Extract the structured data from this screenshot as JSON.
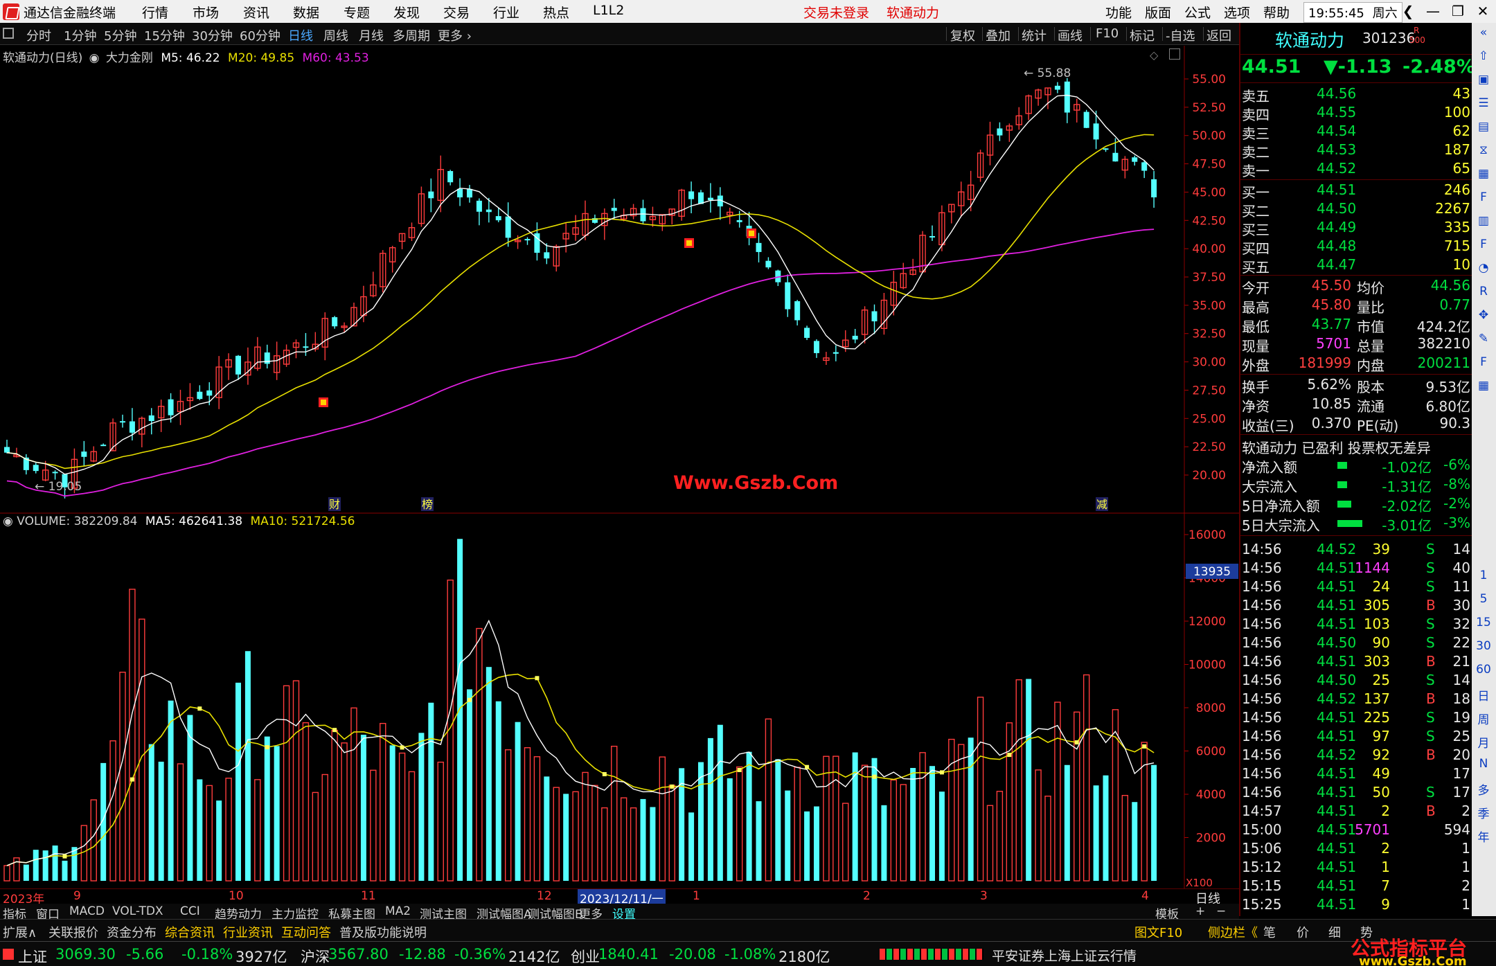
{
  "titlebar": {
    "app_title": "通达信金融终端",
    "menu": [
      "行情",
      "市场",
      "资讯",
      "数据",
      "专题",
      "发现",
      "交易",
      "行业",
      "热点",
      "L1L2"
    ],
    "trade_status": "交易未登录",
    "stock_name": "软通动力",
    "right_menu": [
      "功能",
      "版面",
      "公式",
      "选项",
      "帮助"
    ],
    "clock": "19:55:45",
    "weekday": "周六"
  },
  "periodbar": {
    "periods": [
      "分时",
      "1分钟",
      "5分钟",
      "15分钟",
      "30分钟",
      "60分钟",
      "日线",
      "周线",
      "月线",
      "多周期",
      "更多"
    ],
    "active": "日线",
    "tools": [
      "复权",
      "叠加",
      "统计",
      "画线",
      "F10",
      "标记",
      "-自选",
      "返回"
    ]
  },
  "kline": {
    "legend_name": "软通动力(日线)",
    "indicator": "大力金刚",
    "m5_label": "M5: 46.22",
    "m20_label": "M20: 49.85",
    "m60_label": "M60: 43.53",
    "high_label": "55.88",
    "low_label": "19.05",
    "y_ticks": [
      "55.00",
      "52.50",
      "50.00",
      "47.50",
      "45.00",
      "42.50",
      "40.00",
      "37.50",
      "35.00",
      "32.50",
      "30.00",
      "27.50",
      "25.00",
      "22.50",
      "20.00"
    ],
    "markers": [
      "财",
      "榜",
      "减"
    ],
    "site_watermark": "Www.Gszb.Com"
  },
  "volume": {
    "legend_volume": "VOLUME: 382209.84",
    "legend_ma5": "MA5: 462641.38",
    "legend_ma10": "MA10: 521724.56",
    "y_ticks": [
      "16000",
      "14000",
      "12000",
      "10000",
      "8000",
      "6000",
      "4000",
      "2000"
    ],
    "cursor_value": "13935",
    "unit": "X100"
  },
  "xaxis": {
    "labels": [
      "2023年",
      "9",
      "10",
      "11",
      "12",
      "2023/12/11/一",
      "1",
      "2",
      "3",
      "4"
    ],
    "period_label": "日线"
  },
  "tabs1": [
    "指标",
    "窗口",
    "MACD",
    "VOL-TDX",
    "CCI",
    "趋势动力",
    "主力监控",
    "私募主图",
    "MA2",
    "测试主图",
    "测试幅图A",
    "测试幅图B",
    "更多",
    "设置"
  ],
  "tabs1_right": [
    "模板",
    "+",
    "−"
  ],
  "tabs2": [
    "扩展∧",
    "关联报价",
    "资金分布",
    "综合资讯",
    "行业资讯",
    "互动问答",
    "普及版功能说明"
  ],
  "tabs2_right": [
    "图文F10",
    "侧边栏《",
    "笔",
    "价",
    "细",
    "势"
  ],
  "quote": {
    "name": "软通动力",
    "code": "301236",
    "badge_top": "R",
    "badge_bottom": "500",
    "price": "44.51",
    "change": "▼-1.13",
    "change_pct": "-2.48%",
    "asks": [
      {
        "label": "卖五",
        "price": "44.56",
        "vol": "43"
      },
      {
        "label": "卖四",
        "price": "44.55",
        "vol": "100"
      },
      {
        "label": "卖三",
        "price": "44.54",
        "vol": "62"
      },
      {
        "label": "卖二",
        "price": "44.53",
        "vol": "187"
      },
      {
        "label": "卖一",
        "price": "44.52",
        "vol": "65"
      }
    ],
    "bids": [
      {
        "label": "买一",
        "price": "44.51",
        "vol": "246"
      },
      {
        "label": "买二",
        "price": "44.50",
        "vol": "2267"
      },
      {
        "label": "买三",
        "price": "44.49",
        "vol": "335"
      },
      {
        "label": "买四",
        "price": "44.48",
        "vol": "715"
      },
      {
        "label": "买五",
        "price": "44.47",
        "vol": "10"
      }
    ],
    "stats": [
      {
        "l1": "今开",
        "v1": "45.50",
        "l2": "均价",
        "v2": "44.56",
        "c1": "red2",
        "c2": "green"
      },
      {
        "l1": "最高",
        "v1": "45.80",
        "l2": "量比",
        "v2": "0.77",
        "c1": "red2",
        "c2": "green"
      },
      {
        "l1": "最低",
        "v1": "43.77",
        "l2": "市值",
        "v2": "424.2亿",
        "c1": "green",
        "c2": "white"
      },
      {
        "l1": "现量",
        "v1": "5701",
        "l2": "总量",
        "v2": "382210",
        "c1": "magenta",
        "c2": "white"
      },
      {
        "l1": "外盘",
        "v1": "181999",
        "l2": "内盘",
        "v2": "200211",
        "c1": "red2",
        "c2": "green"
      }
    ],
    "stats2": [
      {
        "l1": "换手",
        "v1": "5.62%",
        "l2": "股本",
        "v2": "9.53亿"
      },
      {
        "l1": "净资",
        "v1": "10.85",
        "l2": "流通",
        "v2": "6.80亿"
      },
      {
        "l1": "收益(三)",
        "v1": "0.370",
        "l2": "PE(动)",
        "v2": "90.3"
      }
    ],
    "tag_line": "软通动力 已盈利 投票权无差异",
    "flows": [
      {
        "label": "净流入额",
        "value": "-1.02亿",
        "pct": "-6%"
      },
      {
        "label": "大宗流入",
        "value": "-1.31亿",
        "pct": "-8%"
      },
      {
        "label": "5日净流入额",
        "value": "-2.02亿",
        "pct": "-2%"
      },
      {
        "label": "5日大宗流入",
        "value": "-3.01亿",
        "pct": "-3%"
      }
    ],
    "ticks": [
      {
        "t": "14:56",
        "p": "44.52",
        "v": "39",
        "s": "S",
        "n": "14"
      },
      {
        "t": "14:56",
        "p": "44.51",
        "v": "1144",
        "s": "S",
        "n": "40"
      },
      {
        "t": "14:56",
        "p": "44.51",
        "v": "24",
        "s": "S",
        "n": "11"
      },
      {
        "t": "14:56",
        "p": "44.51",
        "v": "305",
        "s": "B",
        "n": "30"
      },
      {
        "t": "14:56",
        "p": "44.51",
        "v": "103",
        "s": "S",
        "n": "32"
      },
      {
        "t": "14:56",
        "p": "44.50",
        "v": "90",
        "s": "S",
        "n": "22"
      },
      {
        "t": "14:56",
        "p": "44.51",
        "v": "303",
        "s": "B",
        "n": "21"
      },
      {
        "t": "14:56",
        "p": "44.50",
        "v": "25",
        "s": "S",
        "n": "14"
      },
      {
        "t": "14:56",
        "p": "44.52",
        "v": "137",
        "s": "B",
        "n": "18"
      },
      {
        "t": "14:56",
        "p": "44.51",
        "v": "225",
        "s": "S",
        "n": "19"
      },
      {
        "t": "14:56",
        "p": "44.51",
        "v": "97",
        "s": "S",
        "n": "25"
      },
      {
        "t": "14:56",
        "p": "44.52",
        "v": "92",
        "s": "B",
        "n": "20"
      },
      {
        "t": "14:56",
        "p": "44.51",
        "v": "49",
        "s": "",
        "n": "17"
      },
      {
        "t": "14:56",
        "p": "44.51",
        "v": "50",
        "s": "S",
        "n": "17"
      },
      {
        "t": "14:57",
        "p": "44.51",
        "v": "2",
        "s": "B",
        "n": "2"
      },
      {
        "t": "15:00",
        "p": "44.51",
        "v": "5701",
        "s": "",
        "n": "594"
      },
      {
        "t": "15:06",
        "p": "44.51",
        "v": "2",
        "s": "",
        "n": "1"
      },
      {
        "t": "15:12",
        "p": "44.51",
        "v": "1",
        "s": "",
        "n": "1"
      },
      {
        "t": "15:15",
        "p": "44.51",
        "v": "7",
        "s": "",
        "n": "2"
      },
      {
        "t": "15:25",
        "p": "44.51",
        "v": "9",
        "s": "",
        "n": "1"
      }
    ]
  },
  "sidebar_icons": [
    "collapse-icon",
    "up-arrow-icon",
    "window-icon",
    "list-icon",
    "chart-icon",
    "candle-icon",
    "table-icon",
    "f10-icon",
    "report-icon",
    "fs-icon",
    "clock-icon",
    "rsi-icon",
    "move-icon",
    "pen-icon",
    "fs2-icon",
    "grid-icon"
  ],
  "sidebar_periods": [
    "1",
    "5",
    "15",
    "30",
    "60",
    "日",
    "周",
    "月",
    "N",
    "多",
    "季",
    "年"
  ],
  "statusbar": [
    {
      "name": "上证",
      "value": "3069.30",
      "change": "-5.66",
      "pct": "-0.18%",
      "amount": "3927亿"
    },
    {
      "name": "沪深",
      "value": "3567.80",
      "change": "-12.88",
      "pct": "-0.36%",
      "amount": "2142亿"
    },
    {
      "name": "创业",
      "value": "1840.41",
      "change": "-20.08",
      "pct": "-1.08%",
      "amount": "2180亿"
    }
  ],
  "status_right": "平安证券上海上证云行情",
  "brand_watermark": "公式指标平台",
  "brand_url": "www.Gszb.Com",
  "colors": {
    "up": "#ff3c3c",
    "down": "#54ffff",
    "ma5": "#ffffff",
    "ma20": "#e8e000",
    "ma60": "#e020e0"
  }
}
